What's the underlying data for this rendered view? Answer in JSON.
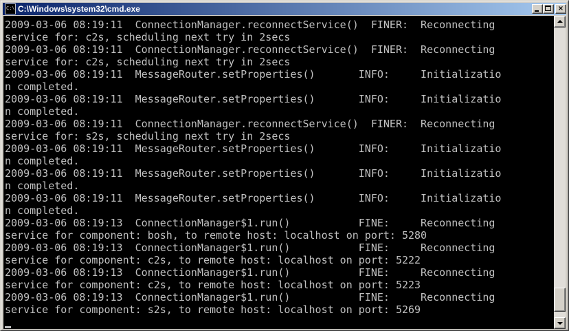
{
  "window": {
    "title": "C:\\Windows\\system32\\cmd.exe",
    "controls": {
      "minimize": "minimize",
      "maximize": "maximize",
      "close": "×"
    }
  },
  "colors": {
    "console_background": "#000000",
    "console_text": "#c0c0c0",
    "titlebar_start": "#0a246a",
    "titlebar_end": "#a6caf0"
  },
  "console": {
    "lines": [
      "2009-03-06 08:19:11  ConnectionManager.reconnectService()  FINER:  Reconnecting",
      "service for: c2s, scheduling next try in 2secs",
      "2009-03-06 08:19:11  ConnectionManager.reconnectService()  FINER:  Reconnecting",
      "service for: c2s, scheduling next try in 2secs",
      "2009-03-06 08:19:11  MessageRouter.setProperties()       INFO:     Initializatio",
      "n completed.",
      "2009-03-06 08:19:11  MessageRouter.setProperties()       INFO:     Initializatio",
      "n completed.",
      "2009-03-06 08:19:11  ConnectionManager.reconnectService()  FINER:  Reconnecting",
      "service for: s2s, scheduling next try in 2secs",
      "2009-03-06 08:19:11  MessageRouter.setProperties()       INFO:     Initializatio",
      "n completed.",
      "2009-03-06 08:19:11  MessageRouter.setProperties()       INFO:     Initializatio",
      "n completed.",
      "2009-03-06 08:19:11  MessageRouter.setProperties()       INFO:     Initializatio",
      "n completed.",
      "2009-03-06 08:19:13  ConnectionManager$1.run()           FINE:     Reconnecting",
      "service for component: bosh, to remote host: localhost on port: 5280",
      "2009-03-06 08:19:13  ConnectionManager$1.run()           FINE:     Reconnecting",
      "service for component: c2s, to remote host: localhost on port: 5222",
      "2009-03-06 08:19:13  ConnectionManager$1.run()           FINE:     Reconnecting",
      "service for component: c2s, to remote host: localhost on port: 5223",
      "2009-03-06 08:19:13  ConnectionManager$1.run()           FINE:     Reconnecting",
      "service for component: s2s, to remote host: localhost on port: 5269"
    ]
  },
  "scrollbar": {
    "position": 0.98
  }
}
